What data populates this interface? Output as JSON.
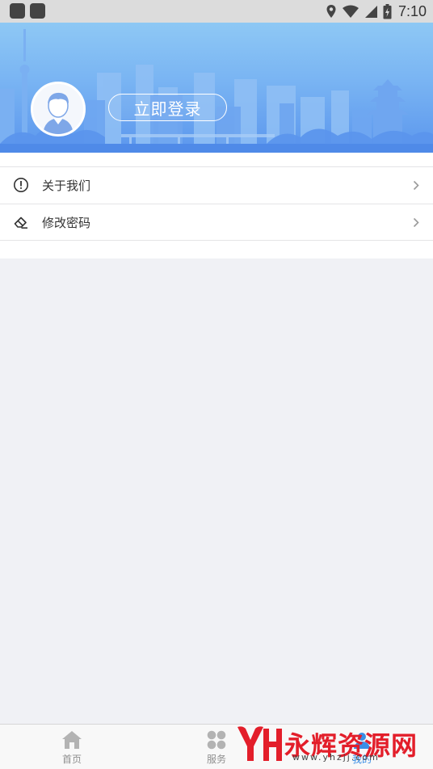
{
  "status_bar": {
    "time": "7:10",
    "icons": [
      "app-notification-icon",
      "app-notification-icon",
      "location-icon",
      "wifi-icon",
      "signal-icon",
      "battery-charging-icon"
    ]
  },
  "header": {
    "login_label": "立即登录",
    "avatar_icon": "user-avatar-icon",
    "gradient_top": "#8ec8f4",
    "gradient_bottom": "#5b96ed"
  },
  "menu": {
    "items": [
      {
        "label": "关于我们",
        "icon": "info-circle-icon"
      },
      {
        "label": "修改密码",
        "icon": "eraser-icon"
      }
    ],
    "arrow_icon": "chevron-right-icon"
  },
  "bottom_nav": {
    "items": [
      {
        "label": "首页",
        "icon": "home-icon",
        "active": false
      },
      {
        "label": "服务",
        "icon": "grid-icon",
        "active": false
      },
      {
        "label": "我的",
        "icon": "profile-icon",
        "active": true
      }
    ],
    "active_color": "#3a8ee6"
  },
  "watermark": {
    "logo_text": "YH",
    "title": "永辉资源网",
    "url": "www.yhzjj.com"
  }
}
